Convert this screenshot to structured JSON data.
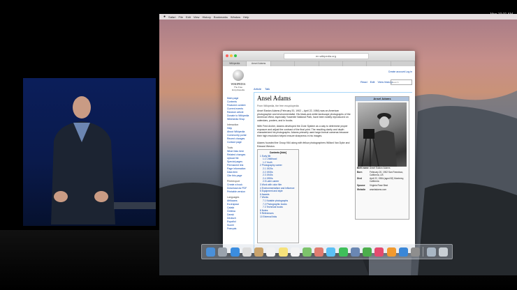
{
  "menubar": {
    "items": [
      "Safari",
      "File",
      "Edit",
      "View",
      "History",
      "Bookmarks",
      "Window",
      "Help"
    ],
    "clock": "Mon 10:31 AM"
  },
  "browser": {
    "url": "en.wikipedia.org",
    "tabs": [
      "Wikipedia",
      "Ansel Adams",
      "",
      "",
      "",
      "",
      "",
      ""
    ]
  },
  "wiki": {
    "logo_name": "WIKIPEDIA",
    "logo_tagline": "The Free Encyclopedia",
    "login": "Create account  Log in",
    "tabs": [
      "Article",
      "Talk"
    ],
    "actions": [
      "Read",
      "Edit",
      "View history"
    ],
    "search_placeholder": "Search",
    "nav": [
      "Main page",
      "Contents",
      "Featured content",
      "Current events",
      "Random article",
      "Donate to Wikipedia",
      "Wikimedia Shop"
    ],
    "interaction_label": "Interaction",
    "interaction": [
      "Help",
      "About Wikipedia",
      "Community portal",
      "Recent changes",
      "Contact page"
    ],
    "tools_label": "Tools",
    "tools": [
      "What links here",
      "Related changes",
      "Upload file",
      "Special pages",
      "Permanent link",
      "Page information",
      "Data item",
      "Cite this page"
    ],
    "print_label": "Print/export",
    "print": [
      "Create a book",
      "Download as PDF",
      "Printable version"
    ],
    "languages_label": "Languages",
    "languages": [
      "Afrikaans",
      "Български",
      "Català",
      "Čeština",
      "Dansk",
      "Deutsch",
      "Español",
      "Suomi",
      "Français"
    ]
  },
  "article": {
    "title": "Ansel Adams",
    "from": "From Wikipedia, the free encyclopedia",
    "para1": "Ansel Easton Adams (February 20, 1902 – April 22, 1984) was an American photographer and environmentalist. His black-and-white landscape photographs of the American West, especially Yosemite National Park, have been widely reproduced on calendars, posters, and in books.",
    "para2": "With Fred Archer, Adams developed the Zone System as a way to determine proper exposure and adjust the contrast of the final print. The resulting clarity and depth characterized his photographs. Adams primarily used large-format cameras because their high resolution helped ensure sharpness in his images.",
    "para3": "Adams founded the Group f/64 along with fellow photographers Willard Van Dyke and Edward Weston.",
    "toc_title": "Contents  [hide]",
    "toc": [
      "1 Early life",
      "1.1 Childhood",
      "1.2 Youth",
      "2 Photography career",
      "2.1 1920s",
      "2.2 1930s",
      "2.3 1940s",
      "2.4 1950s",
      "2.5 Later career",
      "3 Work with color film",
      "4 Environmentalism and influence",
      "5 Equipment and style",
      "6 Awards",
      "7 Works",
      "7.1 Notable photographs",
      "7.2 Photographic books",
      "7.3 Technical books",
      "8 Notes",
      "9 References",
      "10 External links"
    ]
  },
  "infobox": {
    "title": "Ansel Adams",
    "rows": [
      {
        "k": "Birth name",
        "v": "Ansel Easton Adams"
      },
      {
        "k": "Born",
        "v": "February 20, 1902 San Francisco, California, US"
      },
      {
        "k": "Died",
        "v": "April 22, 1984 (aged 82) Monterey, California"
      },
      {
        "k": "Spouse",
        "v": "Virginia Rose Best"
      },
      {
        "k": "Website",
        "v": "anseladams.com"
      }
    ]
  },
  "dock": {
    "icons": [
      {
        "name": "finder-icon",
        "color": "#4a90d9"
      },
      {
        "name": "launchpad-icon",
        "color": "#9aa3ad"
      },
      {
        "name": "safari-icon",
        "color": "#3b8de0"
      },
      {
        "name": "mail-icon",
        "color": "#dcdcdc"
      },
      {
        "name": "contacts-icon",
        "color": "#c9a36b"
      },
      {
        "name": "calendar-icon",
        "color": "#f2f2f2"
      },
      {
        "name": "notes-icon",
        "color": "#f6e27a"
      },
      {
        "name": "reminders-icon",
        "color": "#f4f4f4"
      },
      {
        "name": "maps-icon",
        "color": "#7cc36b"
      },
      {
        "name": "photos-icon",
        "color": "#e07b6f"
      },
      {
        "name": "messages-icon",
        "color": "#5bc0f4"
      },
      {
        "name": "facetime-icon",
        "color": "#3fbf5a"
      },
      {
        "name": "preview-icon",
        "color": "#6a87b3"
      },
      {
        "name": "numbers-icon",
        "color": "#4cae4c"
      },
      {
        "name": "itunes-icon",
        "color": "#e44b6f"
      },
      {
        "name": "ibooks-icon",
        "color": "#f19a2f"
      },
      {
        "name": "app-store-icon",
        "color": "#3a87d8"
      },
      {
        "name": "system-preferences-icon",
        "color": "#8e8e8e"
      },
      {
        "name": "downloads-icon",
        "color": "#a9b7c4"
      },
      {
        "name": "trash-icon",
        "color": "#c9cfd4"
      }
    ]
  }
}
